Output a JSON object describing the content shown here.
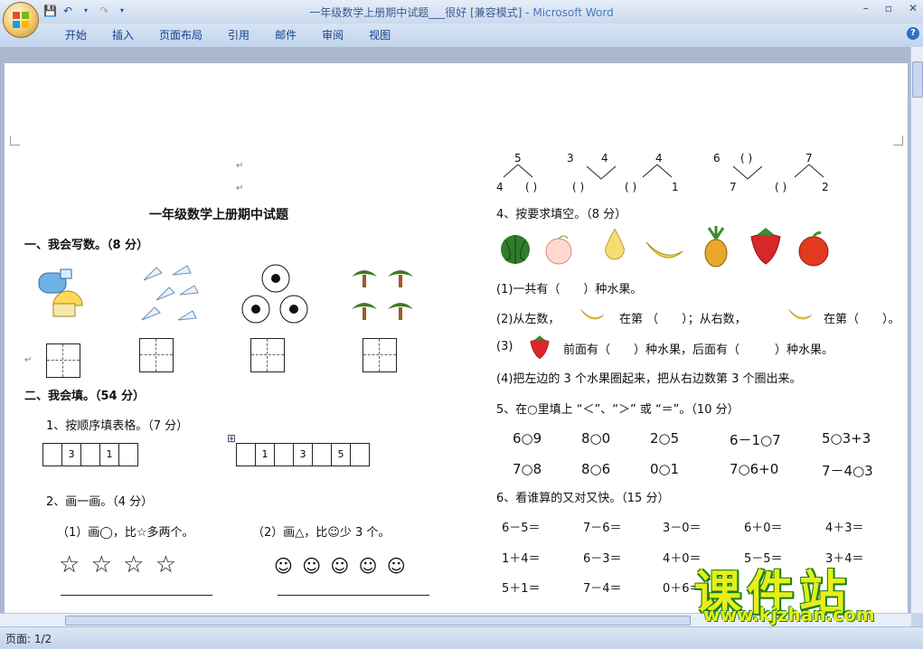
{
  "window": {
    "title": "一年级数学上册期中试题___很好 [兼容模式] - ",
    "app_name": "Microsoft Word",
    "controls": [
      "–",
      "▫",
      "✕"
    ]
  },
  "ribbon": {
    "tabs": [
      "开始",
      "插入",
      "页面布局",
      "引用",
      "邮件",
      "审阅",
      "视图"
    ],
    "help": "?"
  },
  "status": {
    "page": "页面: 1/2"
  },
  "doc": {
    "title": "一年级数学上册期中试题",
    "s1": "一、我会写数。（8 分）",
    "s2": "二、我会填。（54 分）",
    "s2_q1": "1、按顺序填表格。（7 分）",
    "seq1": [
      "",
      "3",
      "",
      "1",
      ""
    ],
    "seq2": [
      "",
      "1",
      "",
      "3",
      "",
      "5",
      ""
    ],
    "s2_q2": "2、画一画。（4 分）",
    "draw1": "（1）画◯，比☆多两个。",
    "draw2": "（2）画△，比☺少 3 个。",
    "stars": "☆ ☆ ☆ ☆",
    "smileys": "☺ ☺ ☺ ☺ ☺",
    "decomp": [
      {
        "top": "5",
        "l": "4",
        "r": "( )"
      },
      {
        "top": "",
        "tl": "3",
        "tr": "4",
        "l": "( )"
      },
      {
        "top": "4",
        "l": "( )",
        "r": "1"
      },
      {
        "tl": "6",
        "tr": "( )",
        "b": "7"
      },
      {
        "top": "7",
        "l": "( )",
        "r": "2"
      }
    ],
    "q4": "4、按要求填空。（8 分）",
    "q4_1": "(1)一共有（　　）种水果。",
    "q4_2a": "(2)从左数，",
    "q4_2b": "在第 （　　）；从右数，",
    "q4_2c": "在第（　　）。",
    "q4_3a": "(3)",
    "q4_3b": "前面有（　　）种水果，后面有（　　　）种水果。",
    "q4_4": "(4)把左边的 3 个水果圈起来，把从右边数第 3 个圈出来。",
    "q5": "5、在○里填上 “＜”、“＞” 或 “＝”。（10 分）",
    "q5_row1": [
      "6○9",
      "8○0",
      "2○5",
      "6－1○7",
      "5○3+3"
    ],
    "q5_row2": [
      "7○8",
      "8○6",
      "0○1",
      "7○6+0",
      "7－4○3"
    ],
    "q6": "6、看谁算的又对又快。（15 分）",
    "q6_row1": [
      "6－5＝",
      "7－6＝",
      "3－0＝",
      "6＋0＝",
      "4＋3＝"
    ],
    "q6_row2": [
      "1＋4＝",
      "6－3＝",
      "4＋0＝",
      "5－5＝",
      "3＋4＝"
    ],
    "q6_row3": [
      "5＋1＝",
      "7－4＝",
      "0＋6＝",
      "",
      ""
    ]
  },
  "watermark": {
    "big": "课件站",
    "url": "www.kjzhan.com"
  },
  "colors": {
    "ribbon": "#c9d9ee",
    "watermark_yellow": "#e8ee1a",
    "watermark_green": "#1a7f14"
  },
  "icons": [
    "office-button-icon",
    "save-icon",
    "undo-icon",
    "redo-icon",
    "help-icon"
  ]
}
